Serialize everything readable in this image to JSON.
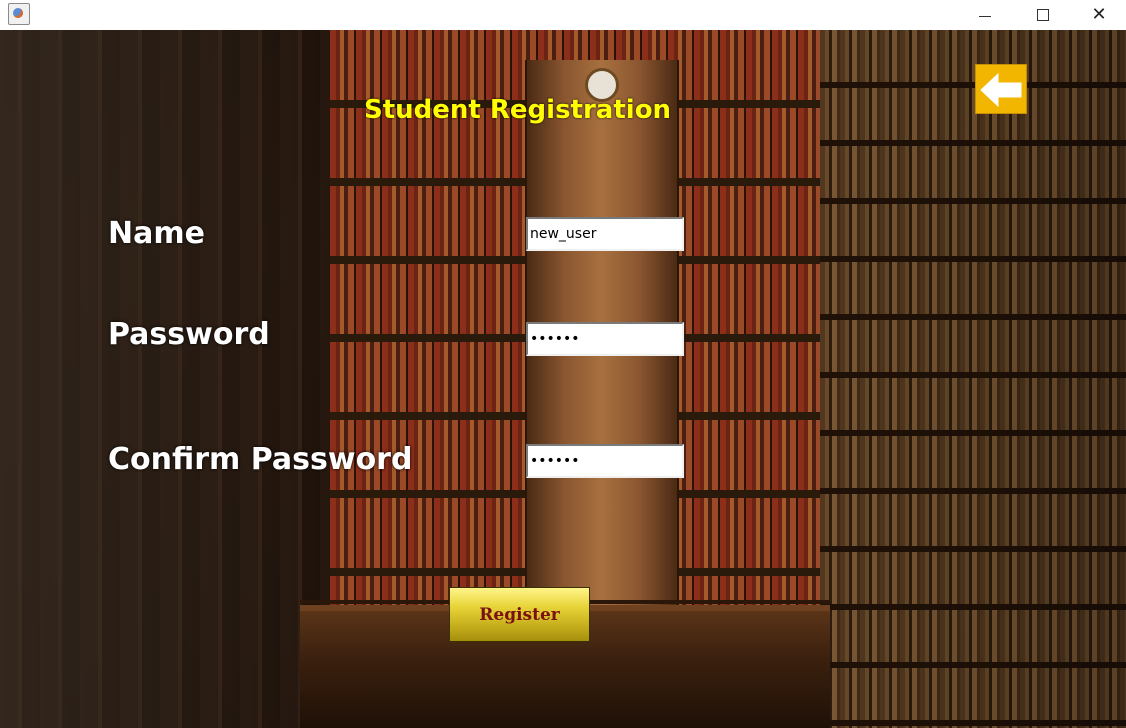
{
  "window": {
    "minimize_symbol": "",
    "close_symbol": "✕"
  },
  "form": {
    "title": "Student Registration",
    "name_label": "Name",
    "password_label": "Password",
    "confirm_label": "Confirm Password",
    "name_value": "new_user",
    "password_value": "••••••",
    "confirm_value": "••••••",
    "register_label": "Register"
  },
  "icons": {
    "back": "back-arrow-icon",
    "app": "java-app-icon"
  },
  "colors": {
    "title": "#ffff00",
    "labels": "#ffffff",
    "back_button": "#f2b500",
    "register_text": "#7a1010"
  }
}
